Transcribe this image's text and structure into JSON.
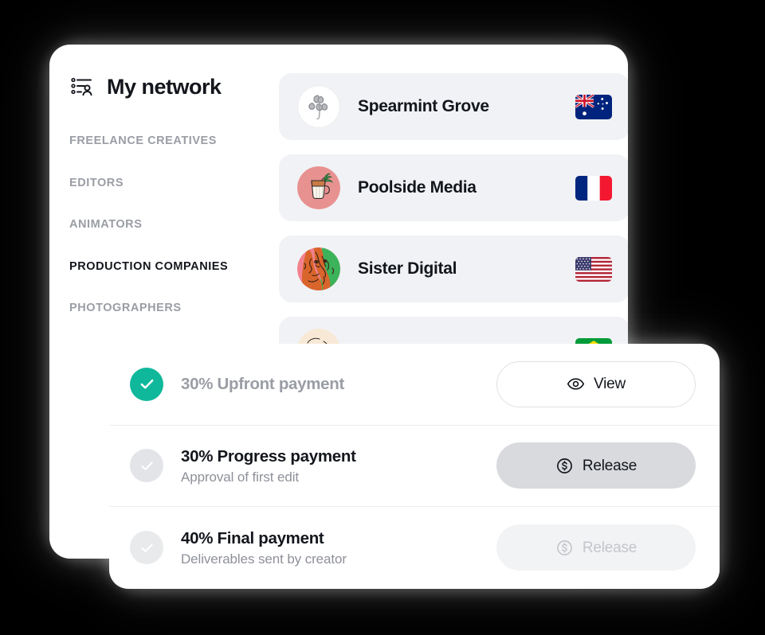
{
  "network_card": {
    "title": "My network",
    "title_icon": "list-person-icon",
    "categories": [
      {
        "label": "FREELANCE CREATIVES",
        "active": false
      },
      {
        "label": "EDITORS",
        "active": false
      },
      {
        "label": "ANIMATORS",
        "active": false
      },
      {
        "label": "PRODUCTION COMPANIES",
        "active": true
      },
      {
        "label": "PHOTOGRAPHERS",
        "active": false
      }
    ],
    "contacts": [
      {
        "name": "Spearmint Grove",
        "avatar_icon": "mint-sprig-avatar",
        "avatar_bg": "#ffffff",
        "flag": "australia-flag",
        "flag_country": "Australia"
      },
      {
        "name": "Poolside Media",
        "avatar_icon": "tropical-drink-avatar",
        "avatar_bg": "#e89191",
        "flag": "france-flag",
        "flag_country": "France"
      },
      {
        "name": "Sister Digital",
        "avatar_icon": "abstract-faces-avatar",
        "avatar_bg": "#e06b3e",
        "flag": "united-states-flag",
        "flag_country": "United States"
      },
      {
        "name": "",
        "avatar_icon": "portrait-avatar",
        "avatar_bg": "#f6e4cf",
        "flag": "brazil-flag",
        "flag_country": "Brazil"
      }
    ]
  },
  "payments_card": {
    "rows": [
      {
        "title": "30% Upfront payment",
        "subtitle": "",
        "state": "completed",
        "check_icon": "check-circle-filled-icon",
        "button": {
          "label": "View",
          "icon": "eye-icon",
          "style": "outline",
          "enabled": true
        }
      },
      {
        "title": "30% Progress payment",
        "subtitle": "Approval of first edit",
        "state": "pending",
        "check_icon": "check-circle-icon",
        "button": {
          "label": "Release",
          "icon": "dollar-circle-icon",
          "style": "solid",
          "enabled": true
        }
      },
      {
        "title": "40% Final payment",
        "subtitle": "Deliverables sent by creator",
        "state": "locked",
        "check_icon": "check-circle-icon",
        "button": {
          "label": "Release",
          "icon": "dollar-circle-icon",
          "style": "disabled",
          "enabled": false
        }
      }
    ]
  },
  "colors": {
    "background": "#000000",
    "card": "#ffffff",
    "row_background": "#f1f2f5",
    "success_green": "#0fb89b",
    "muted_text": "#9a9da5",
    "primary_text": "#13161c",
    "button_solid": "#d8dadd",
    "button_disabled": "#f2f3f5"
  }
}
